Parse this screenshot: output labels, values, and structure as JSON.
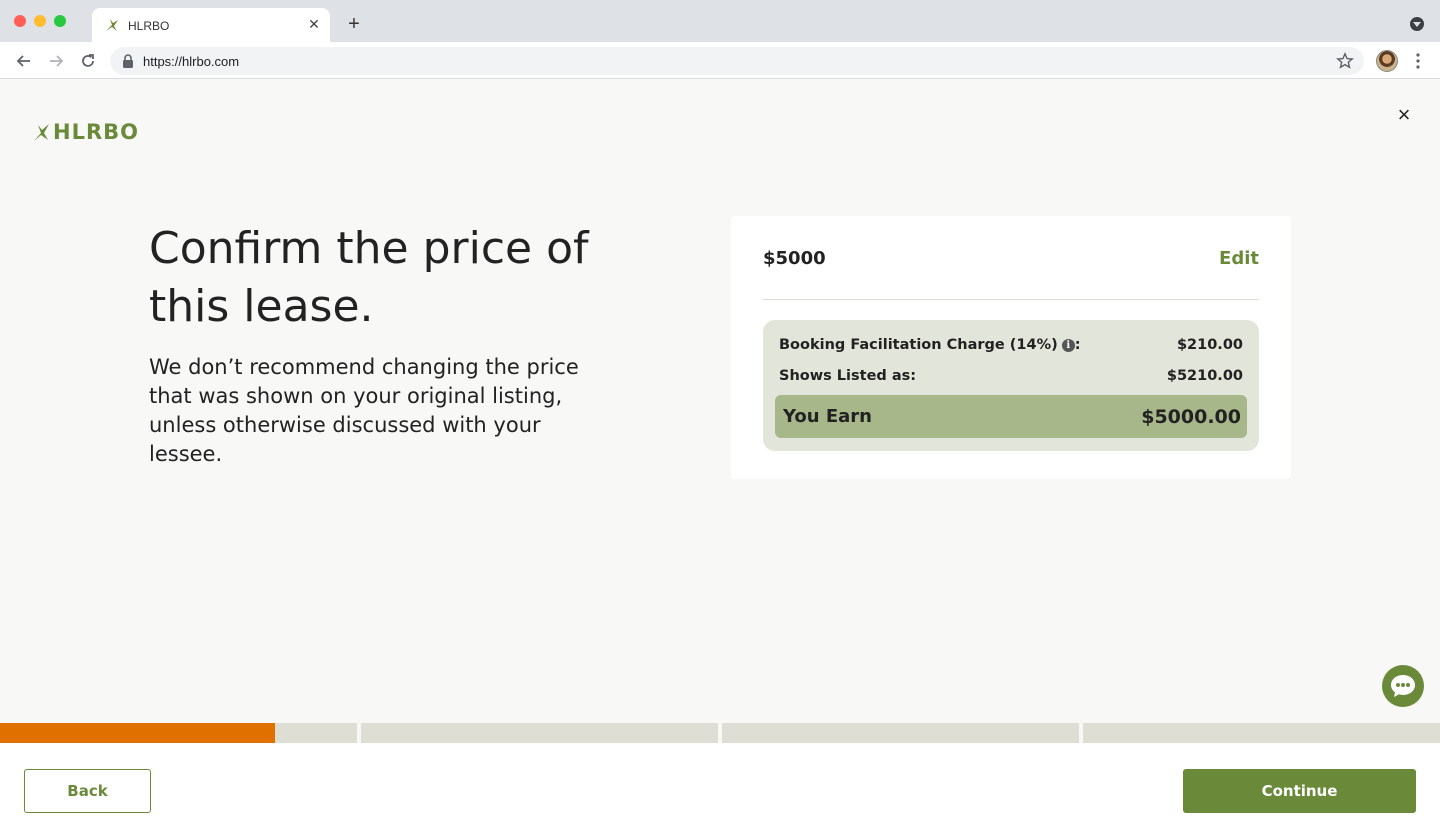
{
  "browser": {
    "tab_title": "HLRBO",
    "url": "https://hlrbo.com",
    "icons": [
      "back-arrow-icon",
      "forward-arrow-icon",
      "reload-icon",
      "lock-icon",
      "star-icon",
      "kebab-menu-icon"
    ]
  },
  "header": {
    "logo_text": "HLRBO",
    "close_glyph": "×"
  },
  "main": {
    "headline": "Confirm the price of this lease.",
    "subtext": "We don’t recommend changing the price that was shown on your original listing, unless otherwise discussed with your lessee."
  },
  "price_card": {
    "price": "$5000",
    "edit_label": "Edit",
    "facilitation_label": "Booking Facilitation Charge (14%)",
    "facilitation_suffix": ":",
    "facilitation_value": "$210.00",
    "listed_label": "Shows Listed as:",
    "listed_value": "$5210.00",
    "earn_label": "You Earn",
    "earn_value": "$5000.00"
  },
  "progress": {
    "steps": 5,
    "current_step_fraction": 0.77
  },
  "footer": {
    "back_label": "Back",
    "continue_label": "Continue"
  },
  "colors": {
    "brand_green": "#6a8a3a",
    "progress_orange": "#e07000",
    "breakdown_bg": "#e2e5d9",
    "earn_bg": "#a8b78a"
  }
}
